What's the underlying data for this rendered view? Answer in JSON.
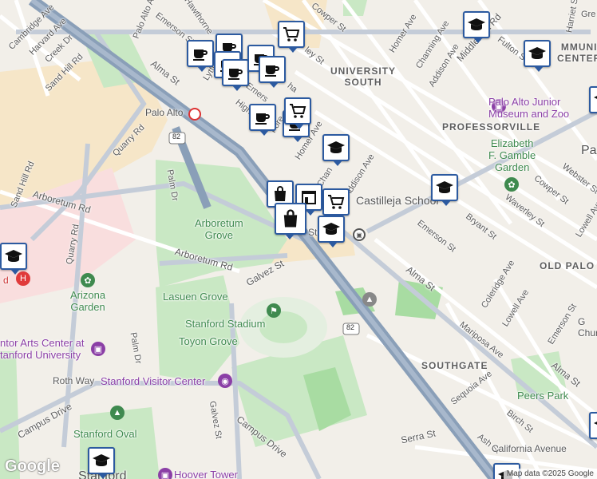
{
  "map": {
    "attribution": "Map data ©2025 Google",
    "logo": "Google"
  },
  "streets": [
    {
      "id": "cambridge-ave",
      "text": "Cambridge Ave"
    },
    {
      "id": "harvard-ave",
      "text": "Harvard Ave"
    },
    {
      "id": "creek-dr",
      "text": "Creek Dr"
    },
    {
      "id": "sand-hill-rd-top",
      "text": "Sand Hill Rd"
    },
    {
      "id": "sand-hill-rd-left",
      "text": "Sand Hill Rd"
    },
    {
      "id": "palo-alto-ave",
      "text": "Palo Alto Ave"
    },
    {
      "id": "hawthorne",
      "text": "Hawthorne"
    },
    {
      "id": "emerson-st-top",
      "text": "Emerson St"
    },
    {
      "id": "cowper-st-top",
      "text": "Cowper St"
    },
    {
      "id": "homer-ave-top",
      "text": "Homer Ave"
    },
    {
      "id": "channing-ave-top",
      "text": "Channing Ave"
    },
    {
      "id": "middlefield-rd",
      "text": "Middlefield Rd"
    },
    {
      "id": "addison-ave-top",
      "text": "Addison Ave"
    },
    {
      "id": "fulton-st",
      "text": "Fulton St"
    },
    {
      "id": "harriet-st",
      "text": "Harriet St"
    },
    {
      "id": "alma-st-top",
      "text": "Alma St"
    },
    {
      "id": "quarry-rd-top",
      "text": "Quarry Rd"
    },
    {
      "id": "quarry-rd-left",
      "text": "Quarry Rd"
    },
    {
      "id": "arboretum-rd-left",
      "text": "Arboretum Rd"
    },
    {
      "id": "arboretum-rd-mid",
      "text": "Arboretum Rd"
    },
    {
      "id": "palm-dr-top",
      "text": "Palm Dr"
    },
    {
      "id": "palm-dr-bottom",
      "text": "Palm Dr"
    },
    {
      "id": "galvez-st-top",
      "text": "Galvez St"
    },
    {
      "id": "galvez-st-bottom",
      "text": "Galvez St"
    },
    {
      "id": "homer-ave-mid",
      "text": "Homer Ave"
    },
    {
      "id": "addison-ave-mid",
      "text": "Addison Ave"
    },
    {
      "id": "emerson-st-mid",
      "text": "Emerson St"
    },
    {
      "id": "bryant-st",
      "text": "Bryant St"
    },
    {
      "id": "waverley-st",
      "text": "Waverley St"
    },
    {
      "id": "cowper-st-mid",
      "text": "Cowper St"
    },
    {
      "id": "webster-st",
      "text": "Webster St"
    },
    {
      "id": "lowell-ave-top",
      "text": "Lowell Ave"
    },
    {
      "id": "alma-st-mid",
      "text": "Alma St"
    },
    {
      "id": "coleridge-ave",
      "text": "Coleridge Ave"
    },
    {
      "id": "lowell-ave-bottom",
      "text": "Lowell Ave"
    },
    {
      "id": "emerson-st-bottom",
      "text": "Emerson St"
    },
    {
      "id": "mariposa-ave",
      "text": "Mariposa Ave"
    },
    {
      "id": "alma-st-bottom",
      "text": "Alma St"
    },
    {
      "id": "sequoia-ave",
      "text": "Sequoia Ave"
    },
    {
      "id": "birch-st",
      "text": "Birch St"
    },
    {
      "id": "ash-st",
      "text": "Ash St"
    },
    {
      "id": "serra-st",
      "text": "Serra St"
    },
    {
      "id": "california-ave",
      "text": "California Avenue"
    },
    {
      "id": "campus-dr-left",
      "text": "Campus Drive"
    },
    {
      "id": "campus-dr-mid",
      "text": "Campus Drive"
    },
    {
      "id": "roth-way",
      "text": "Roth Way"
    },
    {
      "id": "st-fragment",
      "text": "St"
    },
    {
      "id": "chan-fragment",
      "text": "Chan"
    },
    {
      "id": "lytton",
      "text": "Lytto"
    },
    {
      "id": "forest",
      "text": "Fore"
    },
    {
      "id": "high",
      "text": "High"
    },
    {
      "id": "emerson-frag",
      "text": "Emers"
    },
    {
      "id": "ramona-frag",
      "text": "ha"
    },
    {
      "id": "bryant-frag",
      "text": "ley St"
    },
    {
      "id": "palm-frag",
      "text": "Ev"
    },
    {
      "id": "hwy-82-a",
      "text": "82"
    },
    {
      "id": "hwy-82-b",
      "text": "82"
    },
    {
      "id": "hwy-82-c",
      "text": "82"
    }
  ],
  "neighborhoods": [
    {
      "id": "university-south",
      "line1": "UNIVERSITY",
      "line2": "SOUTH"
    },
    {
      "id": "professorville",
      "line1": "PROFESSORVILLE"
    },
    {
      "id": "old-palo",
      "line1": "OLD PALO"
    },
    {
      "id": "southgate",
      "line1": "SOUTHGATE"
    },
    {
      "id": "community-center",
      "line1": "MMUNI",
      "line2": "CENTER"
    },
    {
      "id": "pa-edge",
      "line1": "Pa"
    }
  ],
  "places": [
    {
      "id": "palo-alto-station",
      "text": "Palo Alto"
    },
    {
      "id": "arboretum-grove",
      "line1": "Arboretum",
      "line2": "Grove"
    },
    {
      "id": "arizona-garden",
      "line1": "Arizona",
      "line2": "Garden"
    },
    {
      "id": "lasuen-grove",
      "text": "Lasuen Grove"
    },
    {
      "id": "stanford-stadium",
      "text": "Stanford Stadium"
    },
    {
      "id": "toyon-grove",
      "text": "Toyon Grove"
    },
    {
      "id": "stanford-visitor-center",
      "text": "Stanford Visitor Center"
    },
    {
      "id": "stanford-oval",
      "text": "Stanford Oval"
    },
    {
      "id": "hoover-tower",
      "text": "Hoover Tower"
    },
    {
      "id": "cantor-arts",
      "line1": "ntor Arts Center at",
      "line2": "tanford University"
    },
    {
      "id": "stanford-bottom",
      "text": "Stanford"
    },
    {
      "id": "castilleja-school",
      "text": "Castilleja School"
    },
    {
      "id": "pa-junior-museum",
      "line1": "Palo Alto Junior",
      "line2": "Museum and Zoo"
    },
    {
      "id": "gamble-garden",
      "line1": "Elizabeth",
      "line2": "F. Gamble",
      "line3": "Garden"
    },
    {
      "id": "peers-park",
      "text": "Peers Park"
    },
    {
      "id": "greene-frag",
      "text": "Gre"
    },
    {
      "id": "church-frag",
      "line1": "G",
      "line2": "Churc"
    },
    {
      "id": "hospital-frag",
      "text": "d"
    }
  ],
  "colors": {
    "land": "#f2efe9",
    "park": "#c9e8c4",
    "parkDark": "#a8dca2",
    "road": "#ffffff",
    "arterial": "#c4ccd8",
    "highway": "#8a9fb8",
    "campus": "#f6e6c8",
    "medical": "#f9dede",
    "markerBlue": "#2c5aa0"
  },
  "markers": [
    {
      "id": "cafe-1",
      "icon": "coffee-cup-icon"
    },
    {
      "id": "cafe-2",
      "icon": "coffee-cup-icon"
    },
    {
      "id": "cafe-3",
      "icon": "coffee-cup-icon"
    },
    {
      "id": "cafe-4",
      "icon": "coffee-cup-icon"
    },
    {
      "id": "cafe-5",
      "icon": "coffee-cup-icon"
    },
    {
      "id": "cafe-6",
      "icon": "coffee-cup-icon"
    },
    {
      "id": "cafe-7",
      "icon": "coffee-cup-icon"
    },
    {
      "id": "cart-1",
      "icon": "shopping-cart-icon"
    },
    {
      "id": "cart-2",
      "icon": "shopping-cart-icon"
    },
    {
      "id": "cart-3",
      "icon": "shopping-cart-icon"
    },
    {
      "id": "bag-1",
      "icon": "shopping-bag-icon"
    },
    {
      "id": "bag-2",
      "icon": "shopping-bag-icon"
    },
    {
      "id": "store-1",
      "icon": "storefront-icon"
    },
    {
      "id": "school-1",
      "icon": "graduation-cap-icon"
    },
    {
      "id": "school-2",
      "icon": "graduation-cap-icon"
    },
    {
      "id": "school-3",
      "icon": "graduation-cap-icon"
    },
    {
      "id": "school-4",
      "icon": "graduation-cap-icon"
    },
    {
      "id": "school-5",
      "icon": "graduation-cap-icon"
    },
    {
      "id": "school-6",
      "icon": "graduation-cap-icon"
    },
    {
      "id": "school-7",
      "icon": "graduation-cap-icon"
    },
    {
      "id": "school-8",
      "icon": "graduation-cap-icon"
    },
    {
      "id": "school-9",
      "icon": "graduation-cap-icon"
    }
  ]
}
